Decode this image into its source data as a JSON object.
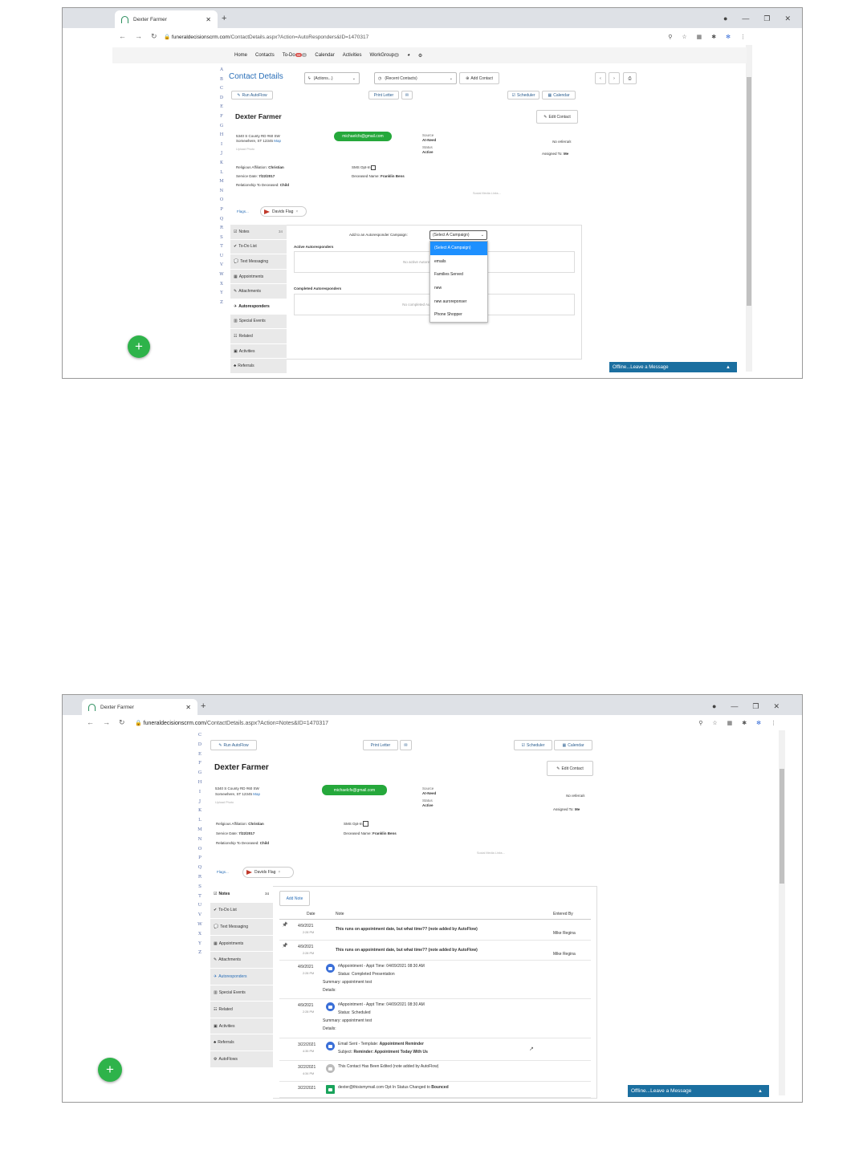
{
  "browser": {
    "tab_title": "Dexter Farmer",
    "url_domain": "funeraldecisionscrm.com",
    "url_path_1": "/ContactDetails.aspx?Action=AutoResponders&ID=1470317",
    "url_path_2": "/ContactDetails.aspx?Action=Notes&ID=1470317"
  },
  "nav": {
    "home": "Home",
    "contacts": "Contacts",
    "todo": "To-Do",
    "todo_badge": "99",
    "calendar": "Calendar",
    "activities": "Activities",
    "workgroup": "WorkGroup",
    "workgroup_badge": "0"
  },
  "alphabet": [
    "A",
    "B",
    "C",
    "D",
    "E",
    "F",
    "G",
    "H",
    "I",
    "J",
    "K",
    "L",
    "M",
    "N",
    "O",
    "P",
    "Q",
    "R",
    "S",
    "T",
    "U",
    "V",
    "W",
    "X",
    "Y",
    "Z"
  ],
  "alphabet2": [
    "C",
    "D",
    "E",
    "F",
    "G",
    "H",
    "I",
    "J",
    "K",
    "L",
    "M",
    "N",
    "O",
    "P",
    "Q",
    "R",
    "S",
    "T",
    "U",
    "V",
    "W",
    "X",
    "Y",
    "Z"
  ],
  "header": {
    "title": "Contact Details",
    "actions": "(Actions...)",
    "recent": "(Recent Contacts)",
    "add_contact": "Add Contact"
  },
  "toolbar": {
    "run_autoflow": "Run AutoFlow",
    "print_letter": "Print Letter",
    "scheduler": "Scheduler",
    "calendar": "Calendar",
    "edit_contact": "Edit Contact"
  },
  "contact": {
    "name": "Dexter Farmer",
    "address1": "5340 S County RD #60 SW",
    "address2": "Somewhere, ST 12345",
    "map": "Map",
    "upload_photo": "Upload Photo",
    "email": "michaelcfs@gmail.com",
    "source_label": "Source",
    "source_value": "At-Need",
    "status_label": "Status",
    "status_value": "Active",
    "no_referrals": "No referrals",
    "assigned_label": "Assigned To:",
    "assigned_value": "Me",
    "religion_label": "Religious Affiliation:",
    "religion_value": "Christian",
    "service_label": "Service Date:",
    "service_value": "7/22/2017",
    "relationship_label": "Relationship To Deceased:",
    "relationship_value": "Child",
    "sms_label": "SMS Opt-In",
    "deceased_label": "Deceased Name:",
    "deceased_value": "Franklin Bens",
    "social": "Social Media Links...",
    "flags_label": "Flags...",
    "flag_name": "Davids Flag"
  },
  "sidebar": {
    "items": [
      {
        "label": "Notes",
        "count": "34"
      },
      {
        "label": "To-Do List"
      },
      {
        "label": "Text Messaging"
      },
      {
        "label": "Appointments"
      },
      {
        "label": "Attachments"
      },
      {
        "label": "Autoresponders"
      },
      {
        "label": "Special Events"
      },
      {
        "label": "Related"
      },
      {
        "label": "Activities"
      },
      {
        "label": "Referrals"
      },
      {
        "label": "AutoFlows"
      }
    ]
  },
  "autoresponders": {
    "add_label": "Add to an Autoresponder Campaign:",
    "select_value": "(Select A Campaign)",
    "active_heading": "Active Autoresponders",
    "active_empty": "No active Autoresp",
    "completed_heading": "Completed Autoresponders",
    "completed_empty": "No completed Autor",
    "options": [
      "(Select A Campaign)",
      "emails",
      "Families Served",
      "new",
      "new auroreponser",
      "Phone Shopper"
    ]
  },
  "notes": {
    "add_note": "Add Note",
    "col_date": "Date",
    "col_note": "Note",
    "col_entered": "Entered By",
    "rows": [
      {
        "date": "4/9/2021",
        "time": "2:28 PM",
        "text": "This runs on appointment date, but what time?? (note added by AutoFlow)",
        "by": "Mike Regina"
      },
      {
        "date": "4/9/2021",
        "time": "2:28 PM",
        "text": "This runs on appointment date, but what time?? (note added by AutoFlow)",
        "by": "Mike Regina"
      },
      {
        "date": "4/9/2021",
        "time": "2:28 PM",
        "l1": "#Appointment - Appt Time: 04/09/2021 08:30 AM",
        "l2": "Status: Completed Presentation",
        "l3": "Summary: appointment test",
        "l4": "Details:"
      },
      {
        "date": "4/9/2021",
        "time": "2:28 PM",
        "l1": "#Appointment - Appt Time: 04/09/2021 08:30 AM",
        "l2": "Status: Scheduled",
        "l3": "Summary: appointment test",
        "l4": "Details:"
      },
      {
        "date": "3/22/2021",
        "time": "4:35 PM",
        "l1a": "Email Sent - Template: ",
        "l1b": "Appointment Reminder",
        "l2a": "Subject: ",
        "l2b": "Reminder: Appointment Today With Us"
      },
      {
        "date": "3/22/2021",
        "time": "4:34 PM",
        "l1": "This Contact Has Been Edited (note added by AutoFlow)"
      },
      {
        "date": "3/22/2021",
        "l1a": "dexter@thisismymail.com Opt In Status Changed to ",
        "l1b": "Bounced"
      }
    ]
  },
  "chat": {
    "label": "Offline...Leave a Message"
  },
  "colors": {
    "accent": "#2a6fb8",
    "green": "#25a83b",
    "chat": "#1b6fa0",
    "highlight": "#1e90ff"
  }
}
